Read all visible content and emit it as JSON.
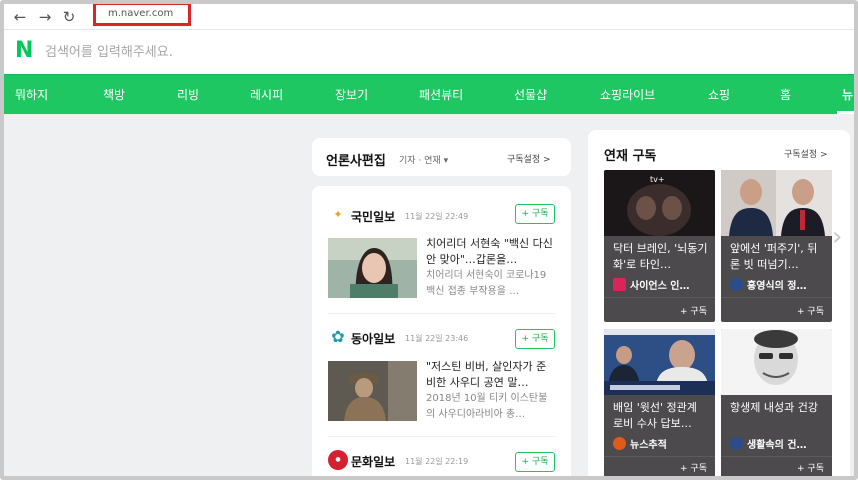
{
  "browser": {
    "url": "m.naver.com",
    "back_icon": "←",
    "forward_icon": "→",
    "reload_icon": "↻"
  },
  "search": {
    "logo": "N",
    "placeholder": "검색어를 입력해주세요."
  },
  "nav_tabs": [
    "뭐하지",
    "책방",
    "리빙",
    "레시피",
    "장보기",
    "패션뷰티",
    "선물샵",
    "쇼핑라이브",
    "쇼핑",
    "홈",
    "뉴"
  ],
  "press_section": {
    "title": "언론사편집",
    "filter": "기자 · 연재 ▾",
    "setting": "구독설정 >",
    "presses": [
      {
        "name": "국민일보",
        "time": "11월 22일 22:49",
        "subscribe": "+ 구독",
        "logo_color": "#e8a21c",
        "title": "치어리더 서현숙 \"백신 다신 안 맞아\"…갑론을…",
        "desc": "치어리더 서현숙이 코로나19 백신 접종 부작용을 …"
      },
      {
        "name": "동아일보",
        "time": "11월 22일 23:46",
        "subscribe": "+ 구독",
        "logo_color": "#1f9aa6",
        "title": "\"저스틴 비버, 살인자가 준비한 사우디 공연 말…",
        "desc": "2018년 10월 티키 이스탄불의 사우디아라비아 총…"
      },
      {
        "name": "문화일보",
        "time": "11월 22일 22:19",
        "subscribe": "+ 구독",
        "logo_color": "#d4202f",
        "title": "",
        "desc": ""
      }
    ]
  },
  "series_section": {
    "title": "연재 구독",
    "setting": "구독설정 >",
    "tiles": [
      {
        "title": "닥터 브레인, '뇌동기화'로 타인…",
        "source": "사이언스 인…",
        "subscribe": "+ 구독",
        "badge": "tv+"
      },
      {
        "title": "앞에선 '퍼주기', 뒤론 빗 떠넘기…",
        "source": "홍영식의 정…",
        "subscribe": "+ 구독",
        "badge": ""
      },
      {
        "title": "배임 '윗선' 정관계 로비 수사 답보…",
        "source": "뉴스추적",
        "subscribe": "+ 구독",
        "badge": ""
      },
      {
        "title": "항생제 내성과 건강",
        "source": "생활속의 건…",
        "subscribe": "+ 구독",
        "badge": ""
      }
    ]
  },
  "colors": {
    "naver_green": "#1ec762",
    "url_highlight": "#d8262b"
  }
}
